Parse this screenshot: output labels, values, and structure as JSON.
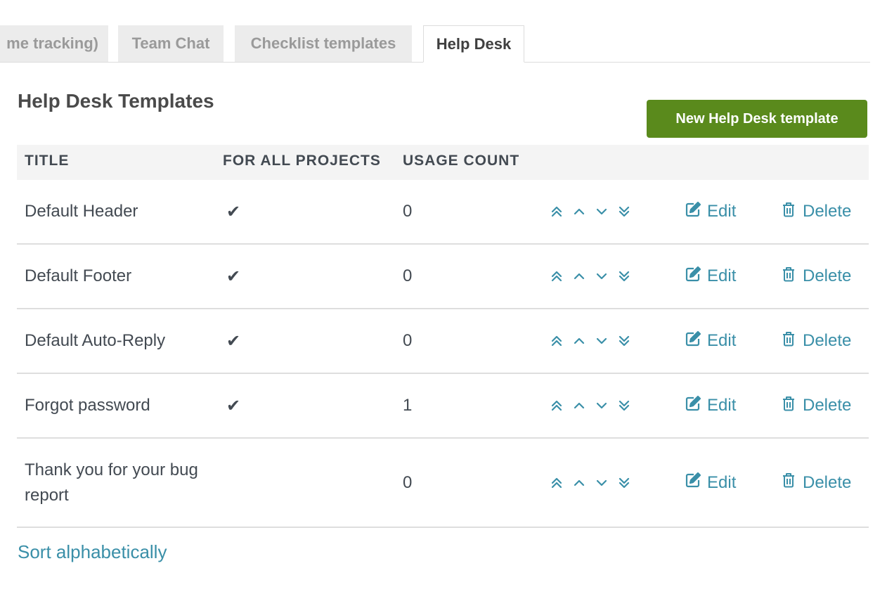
{
  "tabs": [
    {
      "label": "me tracking)",
      "active": false
    },
    {
      "label": "Team Chat",
      "active": false
    },
    {
      "label": "Checklist templates",
      "active": false
    },
    {
      "label": "Help Desk",
      "active": true
    }
  ],
  "page": {
    "title": "Help Desk Templates",
    "new_button_label": "New Help Desk template"
  },
  "table": {
    "columns": [
      "TITLE",
      "FOR ALL PROJECTS",
      "USAGE COUNT"
    ],
    "rows": [
      {
        "title": "Default Header",
        "for_all_projects": true,
        "usage_count": "0"
      },
      {
        "title": "Default Footer",
        "for_all_projects": true,
        "usage_count": "0"
      },
      {
        "title": "Default Auto-Reply",
        "for_all_projects": true,
        "usage_count": "0"
      },
      {
        "title": "Forgot password",
        "for_all_projects": true,
        "usage_count": "1"
      },
      {
        "title": "Thank you for your bug report",
        "for_all_projects": false,
        "usage_count": "0"
      }
    ],
    "edit_label": "Edit",
    "delete_label": "Delete",
    "check_glyph": "✔"
  },
  "footer": {
    "sort_label": "Sort alphabetically"
  },
  "colors": {
    "accent": "#3a8fa8",
    "primary_button": "#5a8a1c"
  }
}
